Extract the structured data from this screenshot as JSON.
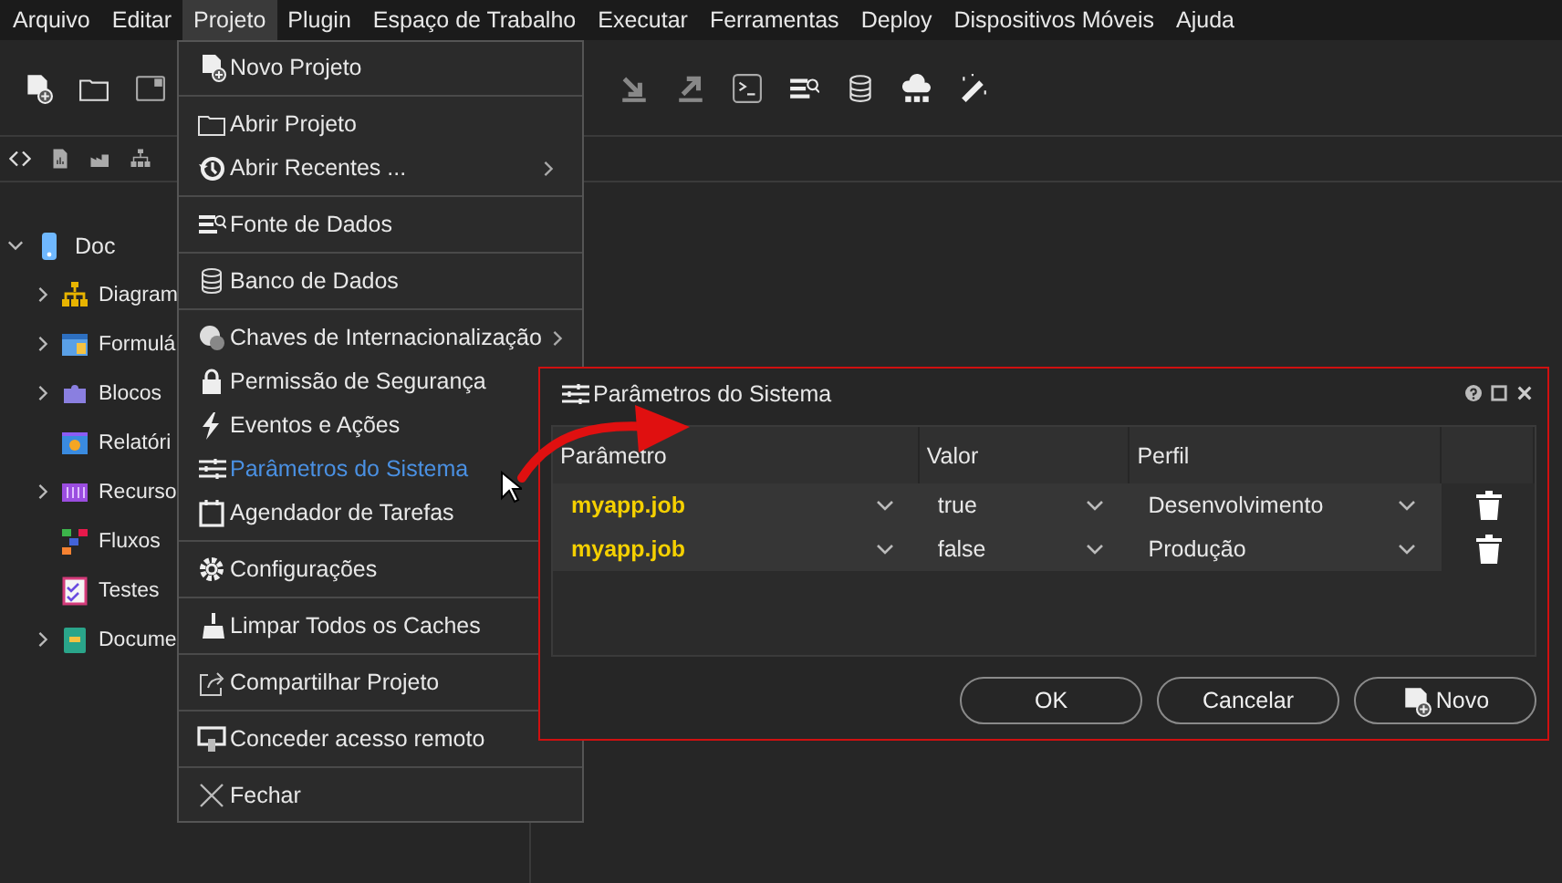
{
  "menu_bar": [
    {
      "label": "Arquivo",
      "selected": false
    },
    {
      "label": "Editar",
      "selected": false
    },
    {
      "label": "Projeto",
      "selected": true
    },
    {
      "label": "Plugin",
      "selected": false
    },
    {
      "label": "Espaço de Trabalho",
      "selected": false
    },
    {
      "label": "Executar",
      "selected": false
    },
    {
      "label": "Ferramentas",
      "selected": false
    },
    {
      "label": "Deploy",
      "selected": false
    },
    {
      "label": "Dispositivos Móveis",
      "selected": false
    },
    {
      "label": "Ajuda",
      "selected": false
    }
  ],
  "tree": {
    "label": "Doc",
    "expanded": true,
    "children": [
      {
        "label": "Diagram",
        "expandable": true
      },
      {
        "label": "Formulá",
        "expandable": true
      },
      {
        "label": "Blocos",
        "expandable": true
      },
      {
        "label": "Relatóri",
        "expandable": false
      },
      {
        "label": "Recurso",
        "expandable": true
      },
      {
        "label": "Fluxos",
        "expandable": false
      },
      {
        "label": "Testes",
        "expandable": false
      },
      {
        "label": "Docume",
        "expandable": true
      }
    ]
  },
  "project_menu": {
    "groups": [
      [
        {
          "label": "Novo Projeto",
          "kind": "command",
          "selected": false
        }
      ],
      [
        {
          "label": "Abrir Projeto",
          "kind": "command",
          "selected": false
        },
        {
          "label": "Abrir Recentes ...",
          "kind": "submenu",
          "selected": false
        }
      ],
      [
        {
          "label": "Fonte de Dados",
          "kind": "command",
          "selected": false
        }
      ],
      [
        {
          "label": "Banco de Dados",
          "kind": "command",
          "selected": false
        }
      ],
      [
        {
          "label": "Chaves de Internacionalização",
          "kind": "submenu",
          "selected": false
        },
        {
          "label": "Permissão de Segurança",
          "kind": "command",
          "selected": false
        },
        {
          "label": "Eventos e Ações",
          "kind": "command",
          "selected": false
        },
        {
          "label": "Parâmetros do Sistema",
          "kind": "command",
          "selected": true
        },
        {
          "label": "Agendador de Tarefas",
          "kind": "command",
          "selected": false
        }
      ],
      [
        {
          "label": "Configurações",
          "kind": "command",
          "selected": false
        }
      ],
      [
        {
          "label": "Limpar Todos os Caches",
          "kind": "command",
          "selected": false
        }
      ],
      [
        {
          "label": "Compartilhar Projeto",
          "kind": "command",
          "selected": false
        }
      ],
      [
        {
          "label": "Conceder acesso remoto",
          "kind": "command",
          "selected": false
        }
      ],
      [
        {
          "label": "Fechar",
          "kind": "command",
          "selected": false
        }
      ]
    ]
  },
  "dialog": {
    "title": "Parâmetros do Sistema",
    "columns": [
      "Parâmetro",
      "Valor",
      "Perfil"
    ],
    "rows": [
      {
        "parameter": "myapp.job",
        "value": "true",
        "profile": "Desenvolvimento"
      },
      {
        "parameter": "myapp.job",
        "value": "false",
        "profile": "Produção"
      }
    ],
    "buttons": [
      {
        "label": "OK",
        "kind": "plain"
      },
      {
        "label": "Cancelar",
        "kind": "plain"
      },
      {
        "label": "Novo",
        "kind": "new"
      }
    ]
  }
}
